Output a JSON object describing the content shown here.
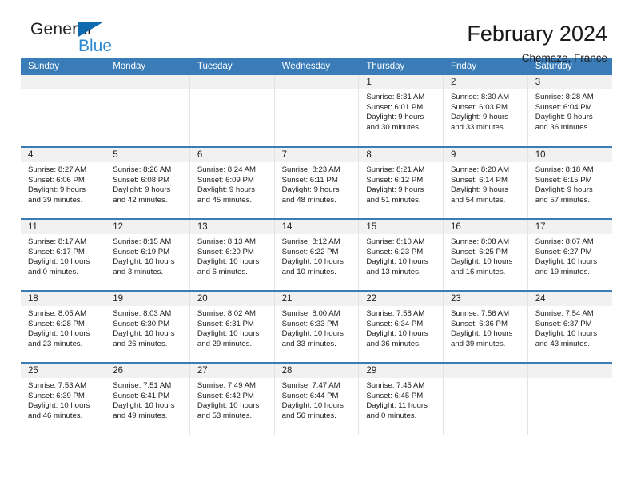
{
  "logo": {
    "word1": "General",
    "word2": "Blue",
    "triangle_color": "#0f6ab0",
    "word2_color": "#2d8bd4"
  },
  "header": {
    "title": "February 2024",
    "subtitle": "Chemaze, France"
  },
  "theme": {
    "header_blue": "#3a7cb8",
    "daynum_band": "#f1f1f1",
    "cell_border": "#e3e3e3"
  },
  "calendar": {
    "weekday_headers": [
      "Sunday",
      "Monday",
      "Tuesday",
      "Wednesday",
      "Thursday",
      "Friday",
      "Saturday"
    ],
    "weeks": [
      [
        {
          "day": "",
          "sunrise": "",
          "sunset": "",
          "daylight_line1": "",
          "daylight_line2": ""
        },
        {
          "day": "",
          "sunrise": "",
          "sunset": "",
          "daylight_line1": "",
          "daylight_line2": ""
        },
        {
          "day": "",
          "sunrise": "",
          "sunset": "",
          "daylight_line1": "",
          "daylight_line2": ""
        },
        {
          "day": "",
          "sunrise": "",
          "sunset": "",
          "daylight_line1": "",
          "daylight_line2": ""
        },
        {
          "day": "1",
          "sunrise": "Sunrise: 8:31 AM",
          "sunset": "Sunset: 6:01 PM",
          "daylight_line1": "Daylight: 9 hours",
          "daylight_line2": "and 30 minutes."
        },
        {
          "day": "2",
          "sunrise": "Sunrise: 8:30 AM",
          "sunset": "Sunset: 6:03 PM",
          "daylight_line1": "Daylight: 9 hours",
          "daylight_line2": "and 33 minutes."
        },
        {
          "day": "3",
          "sunrise": "Sunrise: 8:28 AM",
          "sunset": "Sunset: 6:04 PM",
          "daylight_line1": "Daylight: 9 hours",
          "daylight_line2": "and 36 minutes."
        }
      ],
      [
        {
          "day": "4",
          "sunrise": "Sunrise: 8:27 AM",
          "sunset": "Sunset: 6:06 PM",
          "daylight_line1": "Daylight: 9 hours",
          "daylight_line2": "and 39 minutes."
        },
        {
          "day": "5",
          "sunrise": "Sunrise: 8:26 AM",
          "sunset": "Sunset: 6:08 PM",
          "daylight_line1": "Daylight: 9 hours",
          "daylight_line2": "and 42 minutes."
        },
        {
          "day": "6",
          "sunrise": "Sunrise: 8:24 AM",
          "sunset": "Sunset: 6:09 PM",
          "daylight_line1": "Daylight: 9 hours",
          "daylight_line2": "and 45 minutes."
        },
        {
          "day": "7",
          "sunrise": "Sunrise: 8:23 AM",
          "sunset": "Sunset: 6:11 PM",
          "daylight_line1": "Daylight: 9 hours",
          "daylight_line2": "and 48 minutes."
        },
        {
          "day": "8",
          "sunrise": "Sunrise: 8:21 AM",
          "sunset": "Sunset: 6:12 PM",
          "daylight_line1": "Daylight: 9 hours",
          "daylight_line2": "and 51 minutes."
        },
        {
          "day": "9",
          "sunrise": "Sunrise: 8:20 AM",
          "sunset": "Sunset: 6:14 PM",
          "daylight_line1": "Daylight: 9 hours",
          "daylight_line2": "and 54 minutes."
        },
        {
          "day": "10",
          "sunrise": "Sunrise: 8:18 AM",
          "sunset": "Sunset: 6:15 PM",
          "daylight_line1": "Daylight: 9 hours",
          "daylight_line2": "and 57 minutes."
        }
      ],
      [
        {
          "day": "11",
          "sunrise": "Sunrise: 8:17 AM",
          "sunset": "Sunset: 6:17 PM",
          "daylight_line1": "Daylight: 10 hours",
          "daylight_line2": "and 0 minutes."
        },
        {
          "day": "12",
          "sunrise": "Sunrise: 8:15 AM",
          "sunset": "Sunset: 6:19 PM",
          "daylight_line1": "Daylight: 10 hours",
          "daylight_line2": "and 3 minutes."
        },
        {
          "day": "13",
          "sunrise": "Sunrise: 8:13 AM",
          "sunset": "Sunset: 6:20 PM",
          "daylight_line1": "Daylight: 10 hours",
          "daylight_line2": "and 6 minutes."
        },
        {
          "day": "14",
          "sunrise": "Sunrise: 8:12 AM",
          "sunset": "Sunset: 6:22 PM",
          "daylight_line1": "Daylight: 10 hours",
          "daylight_line2": "and 10 minutes."
        },
        {
          "day": "15",
          "sunrise": "Sunrise: 8:10 AM",
          "sunset": "Sunset: 6:23 PM",
          "daylight_line1": "Daylight: 10 hours",
          "daylight_line2": "and 13 minutes."
        },
        {
          "day": "16",
          "sunrise": "Sunrise: 8:08 AM",
          "sunset": "Sunset: 6:25 PM",
          "daylight_line1": "Daylight: 10 hours",
          "daylight_line2": "and 16 minutes."
        },
        {
          "day": "17",
          "sunrise": "Sunrise: 8:07 AM",
          "sunset": "Sunset: 6:27 PM",
          "daylight_line1": "Daylight: 10 hours",
          "daylight_line2": "and 19 minutes."
        }
      ],
      [
        {
          "day": "18",
          "sunrise": "Sunrise: 8:05 AM",
          "sunset": "Sunset: 6:28 PM",
          "daylight_line1": "Daylight: 10 hours",
          "daylight_line2": "and 23 minutes."
        },
        {
          "day": "19",
          "sunrise": "Sunrise: 8:03 AM",
          "sunset": "Sunset: 6:30 PM",
          "daylight_line1": "Daylight: 10 hours",
          "daylight_line2": "and 26 minutes."
        },
        {
          "day": "20",
          "sunrise": "Sunrise: 8:02 AM",
          "sunset": "Sunset: 6:31 PM",
          "daylight_line1": "Daylight: 10 hours",
          "daylight_line2": "and 29 minutes."
        },
        {
          "day": "21",
          "sunrise": "Sunrise: 8:00 AM",
          "sunset": "Sunset: 6:33 PM",
          "daylight_line1": "Daylight: 10 hours",
          "daylight_line2": "and 33 minutes."
        },
        {
          "day": "22",
          "sunrise": "Sunrise: 7:58 AM",
          "sunset": "Sunset: 6:34 PM",
          "daylight_line1": "Daylight: 10 hours",
          "daylight_line2": "and 36 minutes."
        },
        {
          "day": "23",
          "sunrise": "Sunrise: 7:56 AM",
          "sunset": "Sunset: 6:36 PM",
          "daylight_line1": "Daylight: 10 hours",
          "daylight_line2": "and 39 minutes."
        },
        {
          "day": "24",
          "sunrise": "Sunrise: 7:54 AM",
          "sunset": "Sunset: 6:37 PM",
          "daylight_line1": "Daylight: 10 hours",
          "daylight_line2": "and 43 minutes."
        }
      ],
      [
        {
          "day": "25",
          "sunrise": "Sunrise: 7:53 AM",
          "sunset": "Sunset: 6:39 PM",
          "daylight_line1": "Daylight: 10 hours",
          "daylight_line2": "and 46 minutes."
        },
        {
          "day": "26",
          "sunrise": "Sunrise: 7:51 AM",
          "sunset": "Sunset: 6:41 PM",
          "daylight_line1": "Daylight: 10 hours",
          "daylight_line2": "and 49 minutes."
        },
        {
          "day": "27",
          "sunrise": "Sunrise: 7:49 AM",
          "sunset": "Sunset: 6:42 PM",
          "daylight_line1": "Daylight: 10 hours",
          "daylight_line2": "and 53 minutes."
        },
        {
          "day": "28",
          "sunrise": "Sunrise: 7:47 AM",
          "sunset": "Sunset: 6:44 PM",
          "daylight_line1": "Daylight: 10 hours",
          "daylight_line2": "and 56 minutes."
        },
        {
          "day": "29",
          "sunrise": "Sunrise: 7:45 AM",
          "sunset": "Sunset: 6:45 PM",
          "daylight_line1": "Daylight: 11 hours",
          "daylight_line2": "and 0 minutes."
        },
        {
          "day": "",
          "sunrise": "",
          "sunset": "",
          "daylight_line1": "",
          "daylight_line2": ""
        },
        {
          "day": "",
          "sunrise": "",
          "sunset": "",
          "daylight_line1": "",
          "daylight_line2": ""
        }
      ]
    ]
  }
}
